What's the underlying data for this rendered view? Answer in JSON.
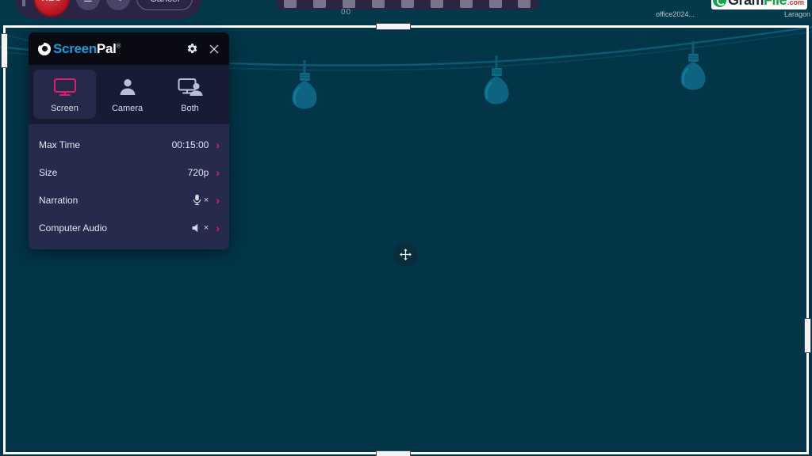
{
  "desktop": {
    "rec_bar": {
      "rec_label": "REC",
      "menu_icon": "hamburger-icon",
      "pen_icon": "pen-icon",
      "cancel_label": "Cancel"
    },
    "app_toolbar": {
      "caption": "00"
    },
    "watermark": {
      "gram": "Gram",
      "file": "File",
      "com": ".com",
      "mark_icon": "gramfile-logo-icon"
    },
    "taskbar": {
      "left_label": "office2024...",
      "right_label": "Laragon"
    }
  },
  "capture": {
    "move_handle_icon": "move-arrows-icon",
    "handles": [
      "top",
      "bottom",
      "left",
      "right"
    ]
  },
  "recorder": {
    "header": {
      "brand_screen": "Screen",
      "brand_pal": "Pal",
      "trademark": "®",
      "logo_icon": "screenpal-logo-icon",
      "settings_icon": "gear-icon",
      "close_icon": "close-icon"
    },
    "tabs": [
      {
        "label": "Screen",
        "icon": "monitor-icon",
        "active": true
      },
      {
        "label": "Camera",
        "icon": "person-icon",
        "active": false
      },
      {
        "label": "Both",
        "icon": "monitor-person-icon",
        "active": false
      }
    ],
    "rows": [
      {
        "label": "Max Time",
        "value": "00:15:00",
        "icon": "",
        "muted": false,
        "chevron": "›"
      },
      {
        "label": "Size",
        "value": "720p",
        "icon": "",
        "muted": false,
        "chevron": "›"
      },
      {
        "label": "Narration",
        "value": "",
        "icon": "microphone-icon",
        "muted": true,
        "chevron": "›"
      },
      {
        "label": "Computer Audio",
        "value": "",
        "icon": "speaker-icon",
        "muted": true,
        "chevron": "›"
      }
    ],
    "mute_mark": "×"
  },
  "colors": {
    "background": "#023548",
    "panel_body": "#262a4d",
    "panel_tabs": "#181b34",
    "panel_header": "#0a0a12",
    "accent_pink": "#e6196e",
    "brand_blue": "#1e9ad6",
    "rec_red": "#b3141f",
    "gramfile_green": "#16a34a"
  }
}
